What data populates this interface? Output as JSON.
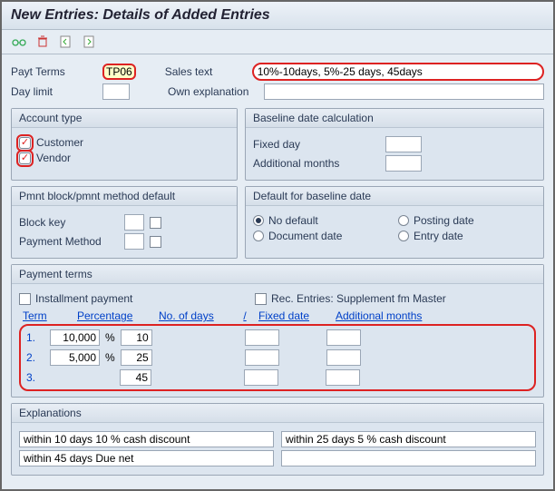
{
  "title": "New Entries: Details of Added Entries",
  "toolbar": {
    "icons": [
      "glasses-icon",
      "delete-icon",
      "prev-icon",
      "next-icon"
    ]
  },
  "header": {
    "payt_terms_label": "Payt Terms",
    "payt_terms_value": "TP06",
    "sales_text_label": "Sales text",
    "sales_text_value": "10%-10days, 5%-25 days, 45days",
    "day_limit_label": "Day limit",
    "day_limit_value": "",
    "own_expl_label": "Own explanation",
    "own_expl_value": ""
  },
  "account_type": {
    "title": "Account type",
    "customer_label": "Customer",
    "customer_checked": true,
    "vendor_label": "Vendor",
    "vendor_checked": true
  },
  "baseline_calc": {
    "title": "Baseline date calculation",
    "fixed_day_label": "Fixed day",
    "fixed_day_value": "",
    "add_months_label": "Additional months",
    "add_months_value": ""
  },
  "pmnt_block": {
    "title": "Pmnt block/pmnt method default",
    "block_key_label": "Block key",
    "block_key_value": "",
    "payment_method_label": "Payment Method",
    "payment_method_value": ""
  },
  "default_baseline": {
    "title": "Default for baseline date",
    "no_default_label": "No default",
    "posting_date_label": "Posting date",
    "document_date_label": "Document date",
    "entry_date_label": "Entry date",
    "selected": "no_default"
  },
  "payment_terms": {
    "title": "Payment terms",
    "installment_label": "Installment payment",
    "installment_checked": false,
    "rec_entries_label": "Rec. Entries: Supplement fm Master",
    "rec_entries_checked": false,
    "hdr_term": "Term",
    "hdr_pct": "Percentage",
    "hdr_days": "No. of days",
    "hdr_slash": "/",
    "hdr_fixed": "Fixed date",
    "hdr_addm": "Additional months",
    "rows": [
      {
        "n": "1.",
        "pct": "10,000",
        "pct_sfx": "%",
        "days": "10",
        "fixed": "",
        "addm": ""
      },
      {
        "n": "2.",
        "pct": "5,000",
        "pct_sfx": "%",
        "days": "25",
        "fixed": "",
        "addm": ""
      },
      {
        "n": "3.",
        "pct": "",
        "pct_sfx": "",
        "days": "45",
        "fixed": "",
        "addm": ""
      }
    ]
  },
  "explanations": {
    "title": "Explanations",
    "lines": [
      "within 10 days 10 % cash discount",
      "within 25 days 5 % cash discount",
      "within 45 days Due net",
      ""
    ]
  }
}
